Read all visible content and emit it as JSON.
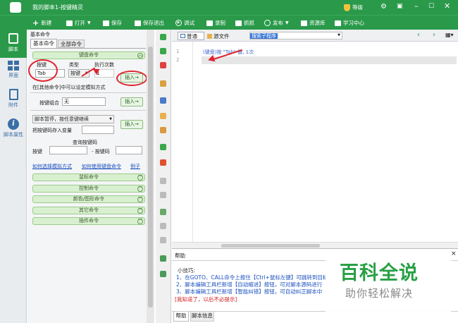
{
  "window": {
    "title": "我的脚本1-按键精灵",
    "user": "等级"
  },
  "toolbar": [
    {
      "label": "新建",
      "icon": "plus-icon"
    },
    {
      "label": "打开",
      "icon": "folder-icon"
    },
    {
      "label": "保存",
      "icon": "save-icon"
    },
    {
      "label": "保存退出",
      "icon": "save-exit-icon"
    },
    {
      "label": "调试",
      "icon": "play-icon"
    },
    {
      "label": "录制",
      "icon": "record-icon"
    },
    {
      "label": "抓抓",
      "icon": "capture-icon"
    },
    {
      "label": "发布",
      "icon": "publish-icon"
    },
    {
      "label": "资源库",
      "icon": "resource-icon"
    },
    {
      "label": "学习中心",
      "icon": "learn-icon"
    }
  ],
  "rail": [
    {
      "label": "脚本",
      "active": true
    },
    {
      "label": "界面"
    },
    {
      "label": "附件"
    },
    {
      "label": "脚本属性"
    }
  ],
  "panel": {
    "title": "基本命令",
    "pin": "ᴘ",
    "tabs": [
      "基本命令",
      "全部命令"
    ],
    "keyboard": {
      "header": "键盘命令",
      "col_key": "按键",
      "col_type": "类型",
      "col_count": "执行次数",
      "key_value": "Tab",
      "type_value": "按键",
      "count_value": "1",
      "insert": "插入→",
      "note": "在[其他命令]中可以设定模拟方式"
    },
    "combo": {
      "label": "按键组合",
      "value": "无",
      "insert": "插入→"
    },
    "pause": {
      "select": "脚本暂停，按任意键继续",
      "label": "把按键码存入变量",
      "insert": "插入→"
    },
    "query": {
      "title": "查询按键码",
      "key_label": "按键",
      "code_label": "- 按键码"
    },
    "links": [
      "如何选择模拟方式",
      "如何使用键盘命令",
      "例子"
    ],
    "sections": [
      "鼠标命令",
      "控制命令",
      "颜色/图形命令",
      "其它命令",
      "插件命令"
    ]
  },
  "editor": {
    "tab_normal": "普通",
    "tab_source": "源文件",
    "select_value": "搜索子程序",
    "lines": [
      "1",
      "2"
    ],
    "code_comment": "(键盘)按 \"Tab\" 键, 1次"
  },
  "help": {
    "title": "帮助",
    "close": "×",
    "tip_title": "小技巧:",
    "tips": [
      "1、在GOTO、CALL命令上按住【Ctrl+鼠标左键】可跳转到目标",
      "2、脚本编辑工具栏新增【自动缩进】按钮，可对脚本源码进行",
      "3、脚本编辑工具栏新增【智能纠错】按钮，可自动纠正脚本中"
    ],
    "dismiss": "[我知道了，以后不必提示]",
    "bottom_tabs": [
      "帮助",
      "脚本信息"
    ]
  },
  "watermark": {
    "line1": "百科全说",
    "line2": "助你轻松解决"
  }
}
